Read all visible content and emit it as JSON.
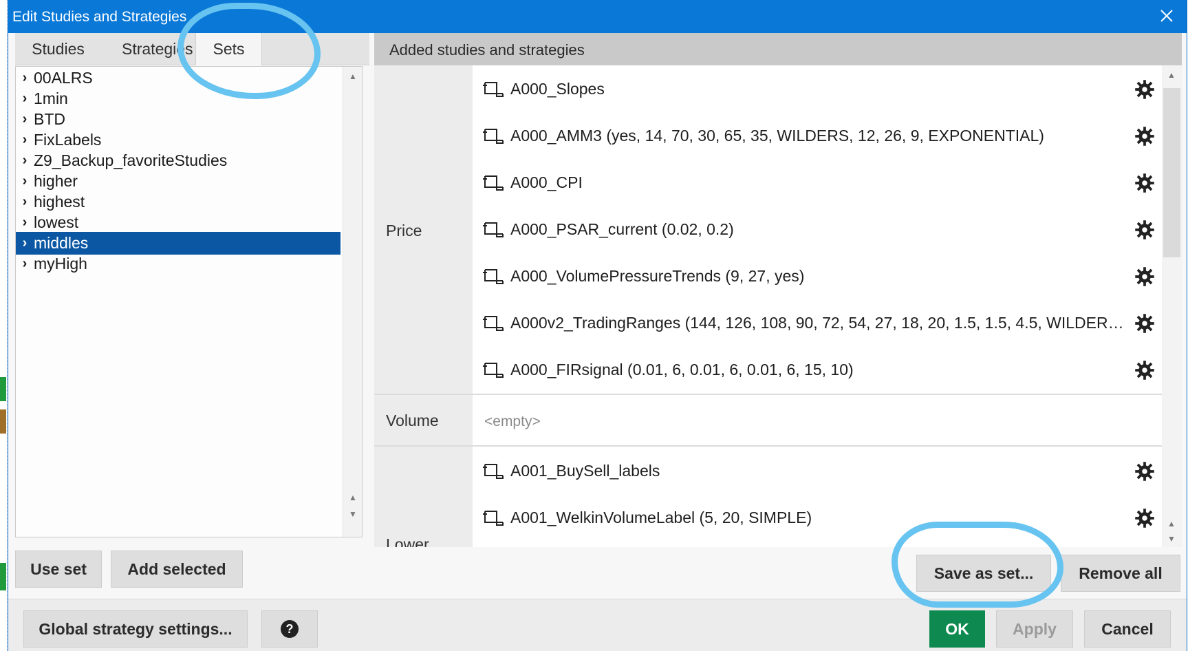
{
  "window": {
    "title": "Edit Studies and Strategies"
  },
  "tabs": [
    {
      "label": "Studies"
    },
    {
      "label": "Strategies"
    },
    {
      "label": "Sets"
    }
  ],
  "sets": [
    {
      "label": "00ALRS"
    },
    {
      "label": "1min"
    },
    {
      "label": "BTD"
    },
    {
      "label": "FixLabels"
    },
    {
      "label": "Z9_Backup_favoriteStudies"
    },
    {
      "label": "higher"
    },
    {
      "label": "highest"
    },
    {
      "label": "lowest"
    },
    {
      "label": "middles",
      "selected": true
    },
    {
      "label": "myHigh"
    }
  ],
  "left_buttons": {
    "use_set": "Use set",
    "add_selected": "Add selected"
  },
  "added": {
    "header": "Added studies and strategies",
    "groups": {
      "price": {
        "label": "Price",
        "studies": [
          {
            "name": "A000_Slopes"
          },
          {
            "name": "A000_AMM3 (yes, 14, 70, 30, 65, 35, WILDERS, 12, 26, 9, EXPONENTIAL)"
          },
          {
            "name": "A000_CPI"
          },
          {
            "name": "A000_PSAR_current (0.02, 0.2)"
          },
          {
            "name": "A000_VolumePressureTrends (9, 27, yes)"
          },
          {
            "name": "A000v2_TradingRanges (144, 126, 108, 90, 72, 54, 27, 18, 20, 1.5, 1.5, 4.5, WILDERS, ..."
          },
          {
            "name": "A000_FIRsignal (0.01, 6, 0.01, 6, 0.01, 6, 15, 10)"
          }
        ]
      },
      "volume": {
        "label": "Volume",
        "empty_text": "<empty>"
      },
      "lower": {
        "label": "Lower",
        "studies": [
          {
            "name": "A001_BuySell_labels"
          },
          {
            "name": "A001_WelkinVolumeLabel (5, 20, SIMPLE)"
          }
        ]
      }
    }
  },
  "right_buttons": {
    "save_as_set": "Save as set...",
    "remove_all": "Remove all"
  },
  "footer": {
    "global_settings": "Global strategy settings...",
    "help": "?",
    "ok": "OK",
    "apply": "Apply",
    "cancel": "Cancel"
  },
  "colors": {
    "titlebar": "#0a78d7",
    "selection": "#0b57a3",
    "ok": "#0e8a50",
    "annotation": "#67c3f0"
  },
  "icons": {
    "study": "study-scroll-icon",
    "settings": "gear-icon",
    "close": "close-icon"
  }
}
